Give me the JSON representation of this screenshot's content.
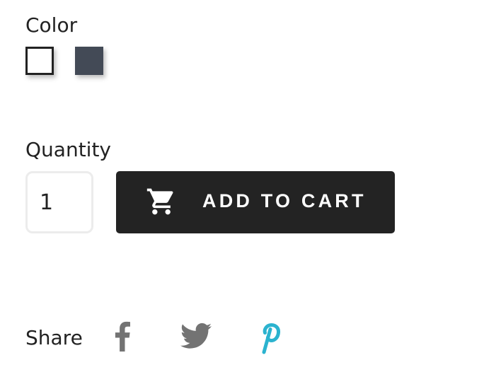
{
  "color": {
    "label": "Color",
    "swatches": [
      {
        "name": "white",
        "hex": "#ffffff",
        "selected": true
      },
      {
        "name": "slate",
        "hex": "#434a56",
        "selected": false
      }
    ]
  },
  "quantity": {
    "label": "Quantity",
    "value": "1"
  },
  "add_to_cart": {
    "icon": "cart-icon",
    "label": "ADD TO CART"
  },
  "share": {
    "label": "Share",
    "icons": [
      {
        "name": "facebook-icon",
        "color": "#737373"
      },
      {
        "name": "twitter-icon",
        "color": "#737373"
      },
      {
        "name": "pinterest-icon",
        "color": "#2bb3cf"
      }
    ]
  }
}
